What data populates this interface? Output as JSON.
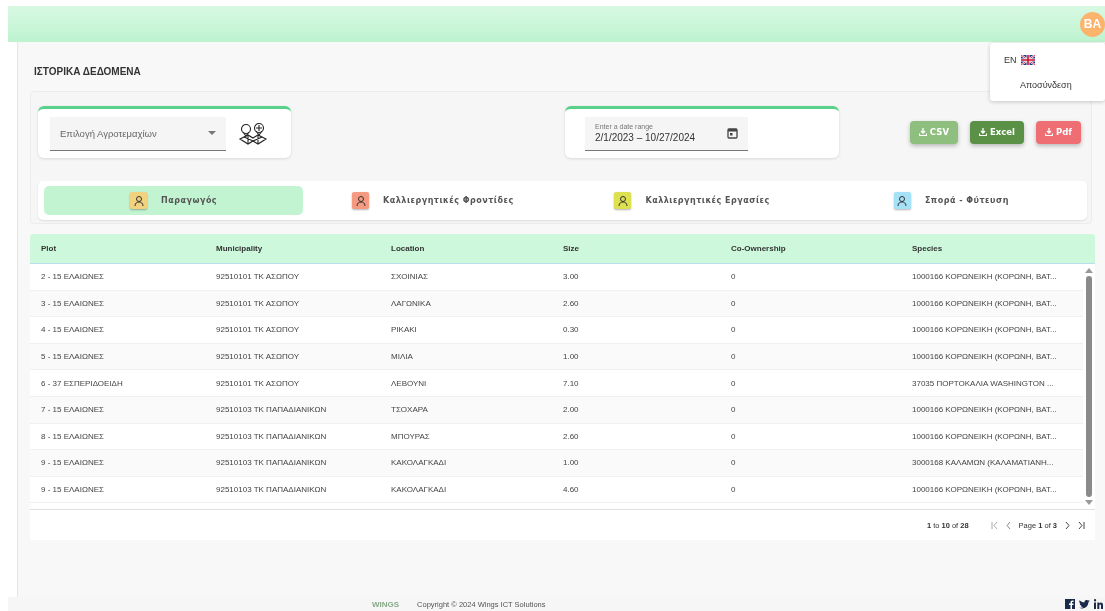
{
  "header": {
    "avatar": "BA"
  },
  "user_menu": {
    "language": "EN",
    "logout": "Αποσύνδεση"
  },
  "page_title": "ΙΣΤΟΡΙΚΑ ΔΕΔΟΜΕΝΑ",
  "plot_select": {
    "placeholder": "Επιλογή Αγροτεμαχίων"
  },
  "date_range": {
    "label": "Enter a date range",
    "value": "2/1/2023 – 10/27/2024"
  },
  "export_buttons": [
    {
      "label": "CSV",
      "color": "#8fbf7e"
    },
    {
      "label": "Excel",
      "color": "#5a9146"
    },
    {
      "label": "Pdf",
      "color": "#ee6e73"
    }
  ],
  "tabs": [
    {
      "label": "Παραγωγός",
      "selected": true,
      "color": "#f3d27f"
    },
    {
      "label": "Καλλιεργητικές Φροντίδες",
      "selected": false,
      "color": "#f59a80"
    },
    {
      "label": "Καλλιεργητικές Εργασίες",
      "selected": false,
      "color": "#dde04f"
    },
    {
      "label": "Σπορά - Φύτευση",
      "selected": false,
      "color": "#a6e2f7"
    }
  ],
  "table": {
    "columns": [
      "Plot",
      "Municipality",
      "Location",
      "Size",
      "Co-Ownership",
      "Species"
    ],
    "rows": [
      [
        "2 - 15 ΕΛΑΙΩΝΕΣ",
        "92510101 ΤΚ ΑΣΩΠΟΥ",
        "ΣΧΟΙΝΙΑΣ",
        "3.00",
        "0",
        "1000166 ΚΟΡΩΝΕΙΚΗ (ΚΟΡΩΝΗ, ΒΑΤ..."
      ],
      [
        "3 - 15 ΕΛΑΙΩΝΕΣ",
        "92510101 ΤΚ ΑΣΩΠΟΥ",
        "ΛΑΓΩΝΙΚΑ",
        "2.60",
        "0",
        "1000166 ΚΟΡΩΝΕΙΚΗ (ΚΟΡΩΝΗ, ΒΑΤ..."
      ],
      [
        "4 - 15 ΕΛΑΙΩΝΕΣ",
        "92510101 ΤΚ ΑΣΩΠΟΥ",
        "ΡΙΚΑΚΙ",
        "0.30",
        "0",
        "1000166 ΚΟΡΩΝΕΙΚΗ (ΚΟΡΩΝΗ, ΒΑΤ..."
      ],
      [
        "5 - 15 ΕΛΑΙΩΝΕΣ",
        "92510101 ΤΚ ΑΣΩΠΟΥ",
        "ΜΙΛΙΑ",
        "1.00",
        "0",
        "1000166 ΚΟΡΩΝΕΙΚΗ (ΚΟΡΩΝΗ, ΒΑΤ..."
      ],
      [
        "6 - 37 ΕΣΠΕΡΙΔΟΕΙΔΗ",
        "92510101 ΤΚ ΑΣΩΠΟΥ",
        "ΛΕΒΟΥΝΙ",
        "7.10",
        "0",
        "37035 ΠΟΡΤΟΚΑΛΙΑ WASHINGTON ..."
      ],
      [
        "7 - 15 ΕΛΑΙΩΝΕΣ",
        "92510103 ΤΚ ΠΑΠΑΔΙΑΝΙΚΩΝ",
        "ΤΣΟΧΑΡΑ",
        "2.00",
        "0",
        "1000166 ΚΟΡΩΝΕΙΚΗ (ΚΟΡΩΝΗ, ΒΑΤ..."
      ],
      [
        "8 - 15 ΕΛΑΙΩΝΕΣ",
        "92510103 ΤΚ ΠΑΠΑΔΙΑΝΙΚΩΝ",
        "ΜΠΟΥΡΑΣ",
        "2.60",
        "0",
        "1000166 ΚΟΡΩΝΕΙΚΗ (ΚΟΡΩΝΗ, ΒΑΤ..."
      ],
      [
        "9 - 15 ΕΛΑΙΩΝΕΣ",
        "92510103 ΤΚ ΠΑΠΑΔΙΑΝΙΚΩΝ",
        "ΚΑΚΟΛΑΓΚΑΔΙ",
        "1.00",
        "0",
        "3000168 ΚΑΛΑΜΩΝ (ΚΑΛΑΜΑΤΙΑΝΗ..."
      ],
      [
        "9 - 15 ΕΛΑΙΩΝΕΣ",
        "92510103 ΤΚ ΠΑΠΑΔΙΑΝΙΚΩΝ",
        "ΚΑΚΟΛΑΓΚΑΔΙ",
        "4.60",
        "0",
        "1000166 ΚΟΡΩΝΕΙΚΗ (ΚΟΡΩΝΗ, ΒΑΤ..."
      ]
    ]
  },
  "pagination": {
    "summary": "**1** to **10** of **28**",
    "page": "Page **1** of **3**"
  },
  "footer": {
    "logo": "WINGS",
    "copyright": "Copyright © 2024 Wings ICT Solutions"
  }
}
